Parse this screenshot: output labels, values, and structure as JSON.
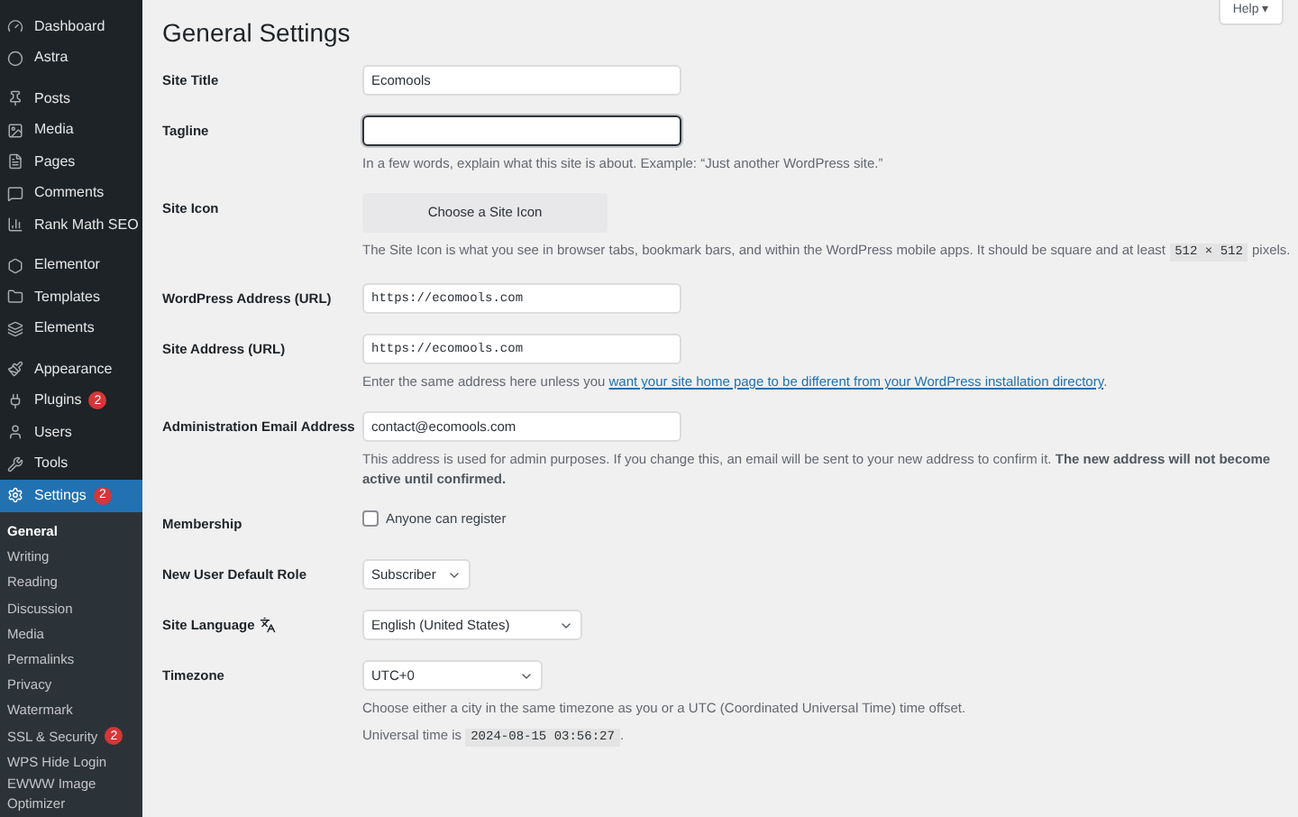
{
  "sidebar": {
    "groups": [
      [
        {
          "label": "Dashboard",
          "selected": false
        },
        {
          "label": "Astra",
          "selected": false
        }
      ],
      [
        {
          "label": "Posts",
          "selected": false
        },
        {
          "label": "Media",
          "selected": false
        },
        {
          "label": "Pages",
          "selected": false
        },
        {
          "label": "Comments",
          "selected": false
        },
        {
          "label": "Rank Math SEO",
          "selected": false
        }
      ],
      [
        {
          "label": "Elementor",
          "selected": false
        },
        {
          "label": "Templates",
          "selected": false
        },
        {
          "label": "Elements",
          "selected": false
        }
      ],
      [
        {
          "label": "Appearance",
          "selected": false
        },
        {
          "label": "Plugins",
          "selected": false,
          "badge": "2"
        },
        {
          "label": "Users",
          "selected": false
        },
        {
          "label": "Tools",
          "selected": false
        },
        {
          "label": "Settings",
          "selected": true,
          "badge": "2"
        }
      ]
    ],
    "submenu": [
      {
        "label": "General",
        "selected": true
      },
      {
        "label": "Writing",
        "selected": false
      },
      {
        "label": "Reading",
        "selected": false
      },
      {
        "label": "Discussion",
        "selected": false
      },
      {
        "label": "Media",
        "selected": false
      },
      {
        "label": "Permalinks",
        "selected": false
      },
      {
        "label": "Privacy",
        "selected": false
      },
      {
        "label": "Watermark",
        "selected": false
      },
      {
        "label": "SSL & Security",
        "selected": false,
        "badge": "2"
      },
      {
        "label": "WPS Hide Login",
        "selected": false
      },
      {
        "label": "EWWW Image Optimizer",
        "selected": false
      }
    ]
  },
  "help_button": "Help ▾",
  "title": "General Settings",
  "fields": [
    {
      "kind": "text",
      "label": "Site Title",
      "value": "Ecomools",
      "focused": false
    },
    {
      "kind": "text",
      "label": "Tagline",
      "focused": true,
      "description": [
        [
          {
            "kind": "text",
            "text": "In a few words, explain what this site is about. Example: “Just another WordPress site.”"
          }
        ]
      ]
    },
    {
      "kind": "button",
      "label": "Site Icon",
      "value": "Choose a Site Icon",
      "description": [
        [
          {
            "kind": "text",
            "text": "The Site Icon is what you see in browser tabs, bookmark bars, and within the WordPress mobile apps. It should be square and at least "
          },
          {
            "kind": "code",
            "text": "512 × 512"
          },
          {
            "kind": "text",
            "text": " pixels."
          }
        ]
      ]
    },
    {
      "kind": "url",
      "label": "WordPress Address (URL)",
      "value": "https://ecomools.com",
      "focused": false
    },
    {
      "kind": "url",
      "label": "Site Address (URL)",
      "value": "https://ecomools.com",
      "focused": false,
      "description": [
        [
          {
            "kind": "text",
            "text": "Enter the same address here unless you "
          },
          {
            "kind": "link",
            "text": "want your site home page to be different from your WordPress installation directory"
          },
          {
            "kind": "text",
            "text": "."
          }
        ]
      ]
    },
    {
      "kind": "text",
      "label": "Administration Email Address",
      "value": "contact@ecomools.com",
      "focused": false,
      "description": [
        [
          {
            "kind": "text",
            "text": "This address is used for admin purposes. If you change this, an email will be sent to your new address to confirm it. "
          },
          {
            "kind": "bold",
            "text": "The new address will not become active until confirmed."
          }
        ]
      ]
    },
    {
      "kind": "checkbox",
      "label": "Membership",
      "value": "Anyone can register",
      "checked": false
    },
    {
      "kind": "select",
      "label": "New User Default Role",
      "value": "Subscriber"
    },
    {
      "kind": "select",
      "label": "Site Language",
      "value": "English (United States)"
    },
    {
      "kind": "select",
      "label": "Timezone",
      "value": "UTC+0",
      "description": [
        [
          {
            "kind": "text",
            "text": "Choose either a city in the same timezone as you or a UTC (Coordinated Universal Time) time offset."
          }
        ],
        [
          {
            "kind": "text",
            "text": "Universal time is "
          },
          {
            "kind": "code",
            "text": "2024-08-15 03:56:27"
          },
          {
            "kind": "text",
            "text": "."
          }
        ]
      ]
    }
  ]
}
